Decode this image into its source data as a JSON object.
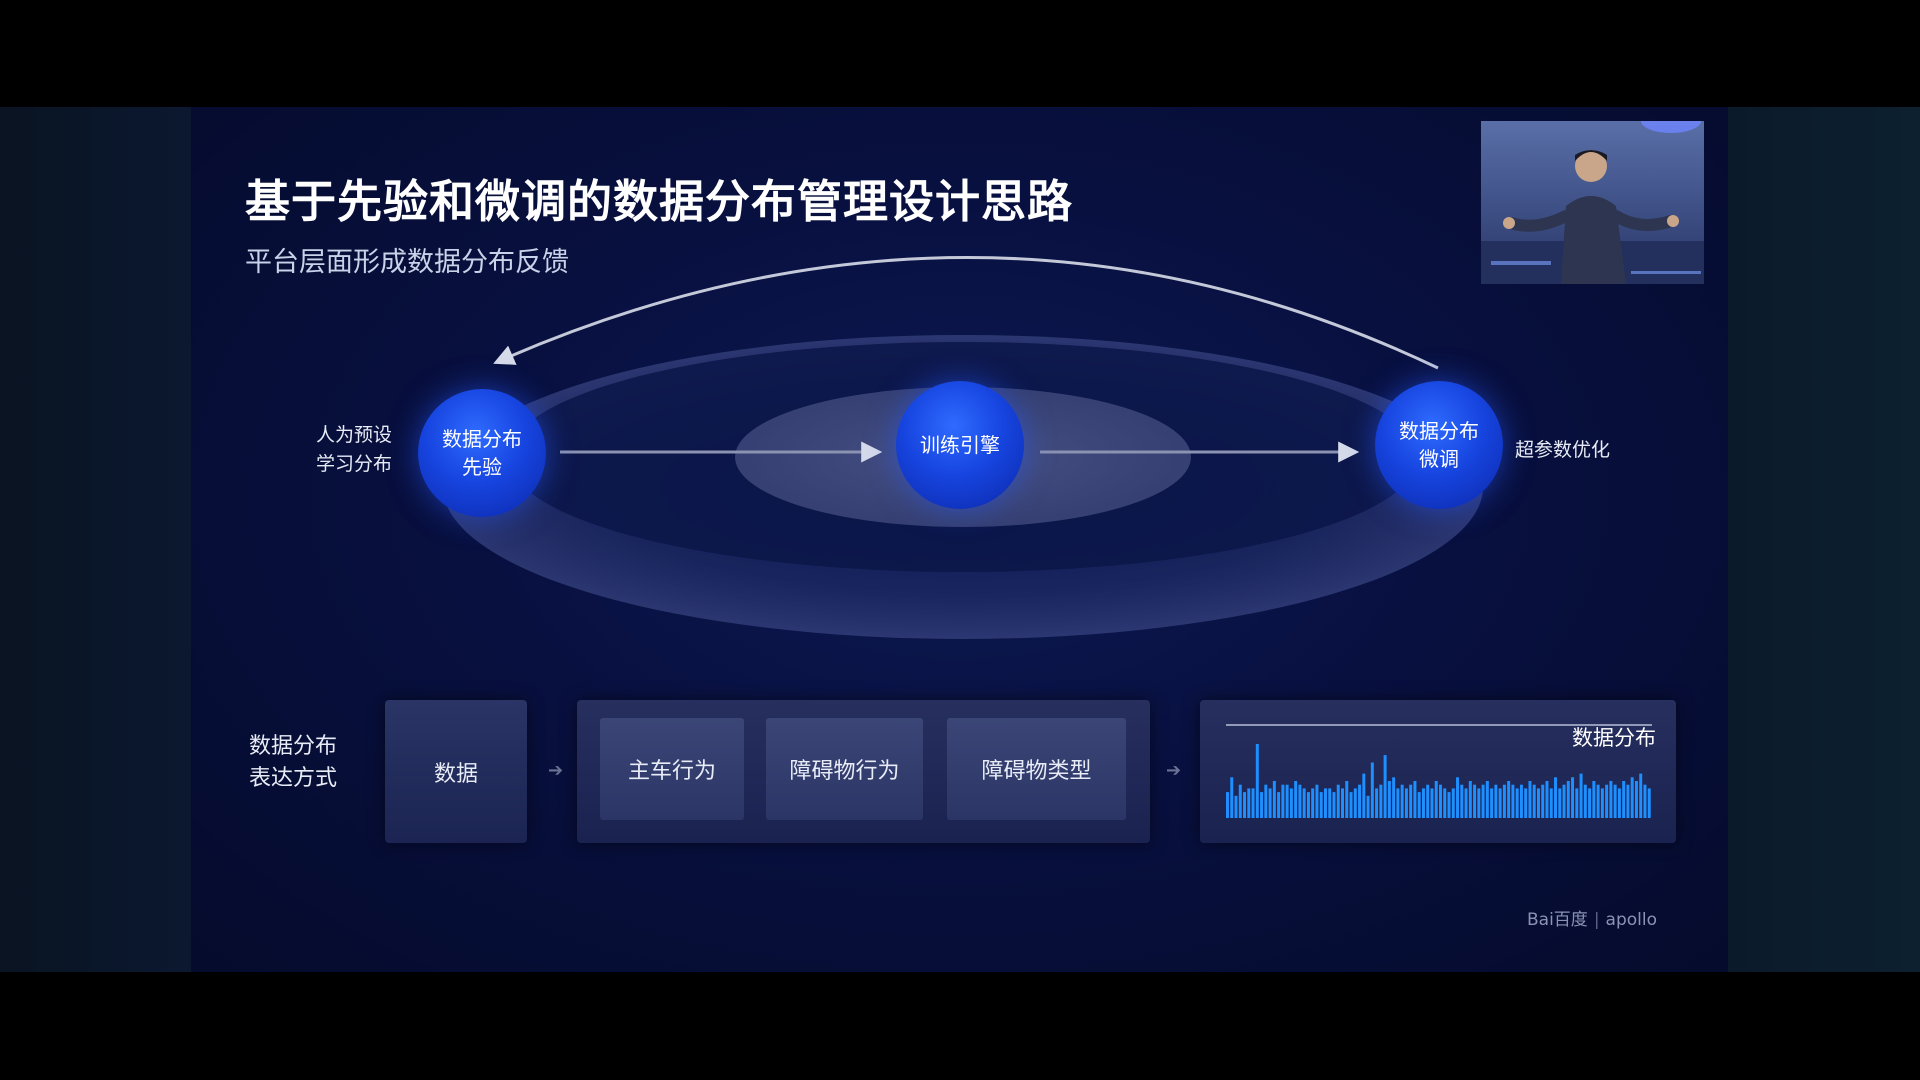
{
  "slide": {
    "title": "基于先验和微调的数据分布管理设计思路",
    "subtitle": "平台层面形成数据分布反馈"
  },
  "diagram": {
    "left_label_line1": "人为预设",
    "left_label_line2": "学习分布",
    "right_label": "超参数优化",
    "nodes": {
      "prior_line1": "数据分布",
      "prior_line2": "先验",
      "engine": "训练引擎",
      "finetune_line1": "数据分布",
      "finetune_line2": "微调"
    }
  },
  "expression": {
    "label_line1": "数据分布",
    "label_line2": "表达方式",
    "data_box": "数据",
    "categories": [
      "主车行为",
      "障碍物行为",
      "障碍物类型"
    ],
    "arrow_glyph": "➔",
    "distribution_title": "数据分布",
    "histogram_values": [
      0.35,
      0.55,
      0.3,
      0.45,
      0.35,
      0.4,
      0.4,
      1.0,
      0.35,
      0.45,
      0.4,
      0.5,
      0.35,
      0.45,
      0.45,
      0.4,
      0.5,
      0.45,
      0.4,
      0.35,
      0.4,
      0.45,
      0.35,
      0.4,
      0.4,
      0.35,
      0.45,
      0.4,
      0.5,
      0.35,
      0.4,
      0.45,
      0.6,
      0.3,
      0.75,
      0.4,
      0.45,
      0.85,
      0.5,
      0.55,
      0.4,
      0.45,
      0.4,
      0.45,
      0.5,
      0.35,
      0.4,
      0.45,
      0.4,
      0.5,
      0.45,
      0.4,
      0.35,
      0.4,
      0.55,
      0.45,
      0.4,
      0.5,
      0.45,
      0.4,
      0.45,
      0.5,
      0.4,
      0.45,
      0.4,
      0.45,
      0.5,
      0.45,
      0.4,
      0.45,
      0.4,
      0.5,
      0.45,
      0.4,
      0.45,
      0.5,
      0.4,
      0.55,
      0.4,
      0.45,
      0.5,
      0.55,
      0.4,
      0.6,
      0.45,
      0.4,
      0.5,
      0.45,
      0.4,
      0.45,
      0.5,
      0.45,
      0.4,
      0.5,
      0.45,
      0.55,
      0.5,
      0.6,
      0.45,
      0.4
    ]
  },
  "logo": {
    "baidu": "Bai百度",
    "apollo": "apollo"
  },
  "colors": {
    "node_blue": "#1745e0",
    "histogram_bar": "#1e8fff"
  }
}
